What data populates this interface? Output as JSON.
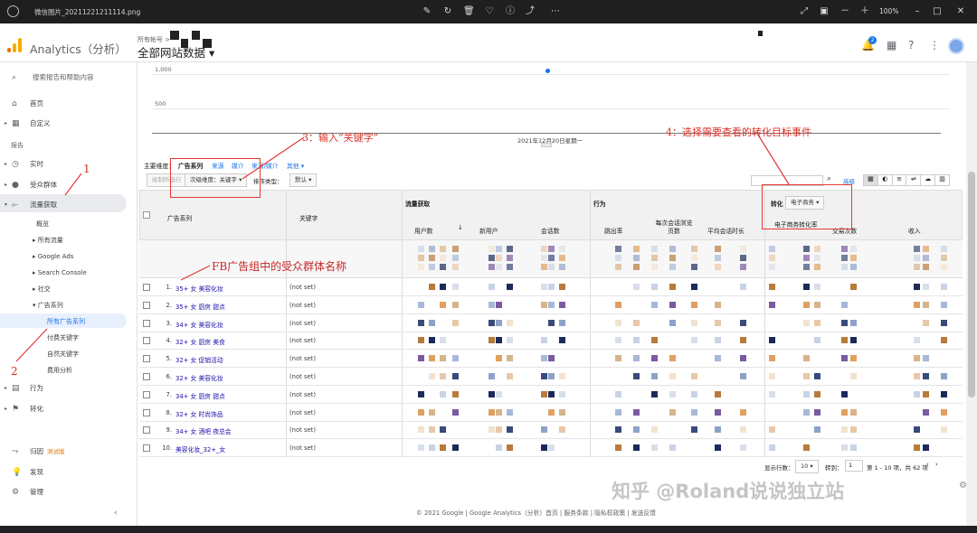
{
  "viewer": {
    "title": "微信图片_20211221211114.png",
    "zoom": "100%"
  },
  "header": {
    "product": "Analytics（分析）",
    "account_crumb": "所有帐号 >",
    "property": "全部网站数据",
    "notification_count": "2"
  },
  "search": {
    "placeholder": "搜索报告和帮助内容"
  },
  "sidebar": {
    "home": "首页",
    "custom": "自定义",
    "reports_heading": "报告",
    "realtime": "实时",
    "audience": "受众群体",
    "acquisition": "流量获取",
    "acq_sub": {
      "overview": "概览",
      "all_traffic": "所有流量",
      "google_ads": "Google Ads",
      "search_console": "Search Console",
      "social": "社交",
      "campaigns": "广告系列"
    },
    "campaign_sub": {
      "all": "所有广告系列",
      "paid": "付费关键字",
      "organic": "自然关键字",
      "cost": "费用分析"
    },
    "behavior": "行为",
    "conversions": "转化",
    "attribution": "归因",
    "beta": "测试版",
    "discover": "发现",
    "admin": "管理"
  },
  "chart": {
    "y_ticks": [
      "1,000",
      "500"
    ],
    "x_label": "2021年12月20日星期一"
  },
  "dims": {
    "label": "主要维度：",
    "items": [
      "广告系列",
      "来源",
      "媒介",
      "来源/媒介",
      "其他"
    ]
  },
  "toolbar": {
    "plot_rows": "绘制所选行",
    "secondary_dim": "次级维度：关键字",
    "sort_label": "排序类型：",
    "sort_value": "默认",
    "conversion_label": "转化",
    "conversion_value": "电子商务",
    "advanced": "高级"
  },
  "table": {
    "group_acq": "流量获取",
    "group_beh": "行为",
    "col_campaign": "广告系列",
    "col_keyword": "关键字",
    "col_users": "用户数",
    "col_new": "新用户",
    "col_sessions": "会话数",
    "col_bounce": "跳出率",
    "col_pps": "每次会话浏览页数",
    "col_dur": "平均会话时长",
    "col_conv_rate": "电子商务转化率",
    "col_trans": "交易次数",
    "col_rev": "收入",
    "rows": [
      {
        "n": "1.",
        "c": "35+ 女 美容化妆",
        "k": "(not set)"
      },
      {
        "n": "2.",
        "c": "35+ 女 厨房 甜点",
        "k": "(not set)"
      },
      {
        "n": "3.",
        "c": "34+ 女 美容化妆",
        "k": "(not set)"
      },
      {
        "n": "4.",
        "c": "32+ 女 厨房 美食",
        "k": "(not set)"
      },
      {
        "n": "5.",
        "c": "32+ 女 促销活动",
        "k": "(not set)"
      },
      {
        "n": "6.",
        "c": "32+ 女 美容化妆",
        "k": "(not set)"
      },
      {
        "n": "7.",
        "c": "34+ 女 厨房 甜点",
        "k": "(not set)"
      },
      {
        "n": "8.",
        "c": "32+ 女 时尚饰品",
        "k": "(not set)"
      },
      {
        "n": "9.",
        "c": "34+ 女 酒吧 夜总会",
        "k": "(not set)"
      },
      {
        "n": "10.",
        "c": "美容化妆_32+_女",
        "k": "(not set)"
      }
    ]
  },
  "pagination": {
    "rows_label": "显示行数：",
    "rows_value": "10",
    "goto_label": "转到：",
    "goto_value": "1",
    "range": "第 1 - 10 项，共 62 项"
  },
  "footer": "© 2021 Google | Google Analytics（分析）首页 | 服务条款 | 隐私权政策 | 发送反馈",
  "annotations": {
    "a1": "1",
    "a2": "2",
    "a3": "3：输入“关键字”",
    "a4": "4：选择需要查看的转化目标事件",
    "fb": "FB广告组中的受众群体名称"
  },
  "watermark": "知乎 @Roland说说独立站",
  "colors": {
    "accent": "#1a73e8",
    "annotation": "#e53935",
    "logo_orange": "#f9ab00",
    "logo_dark": "#e37400"
  }
}
